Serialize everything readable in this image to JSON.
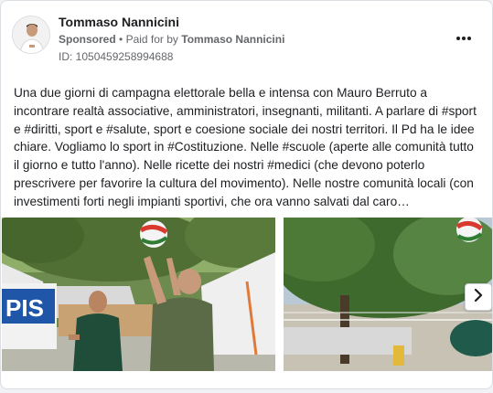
{
  "ad": {
    "advertiser": "Tommaso Nannicini",
    "sponsored_label": "Sponsored",
    "separator": "•",
    "paid_for_prefix": "Paid for by",
    "paid_for_by": "Tommaso Nannicini",
    "id_label": "ID: 1050459258994688",
    "more_icon": "more-options-icon",
    "body": "Una due giorni di campagna elettorale bella e intensa con Mauro Berruto a incontrare realtà associative, amministratori, insegnanti, militanti. A parlare di #sport e #diritti, sport e #salute, sport e coesione sociale dei nostri territori. Il Pd ha le idee chiare. Vogliamo lo sport in #Costituzione. Nelle #scuole (aperte alle comunità tutto il giorno e tutto l'anno). Nelle ricette dei nostri #medici (che devono poterlo prescrivere per favorire la cultura del movimento). Nelle nostre comunità locali (con investimenti forti negli impianti sportivi, che ora vanno salvati dal caro…"
  },
  "carousel": {
    "images": [
      {
        "alt": "Volleyball match outdoors near white tents",
        "tent_text": "PIS"
      },
      {
        "alt": "Volleyball outdoors under a large tree"
      }
    ],
    "next_icon": "chevron-right-icon"
  },
  "colors": {
    "text": "#1c1e21",
    "secondary": "#65676b",
    "border": "#dadde1"
  }
}
